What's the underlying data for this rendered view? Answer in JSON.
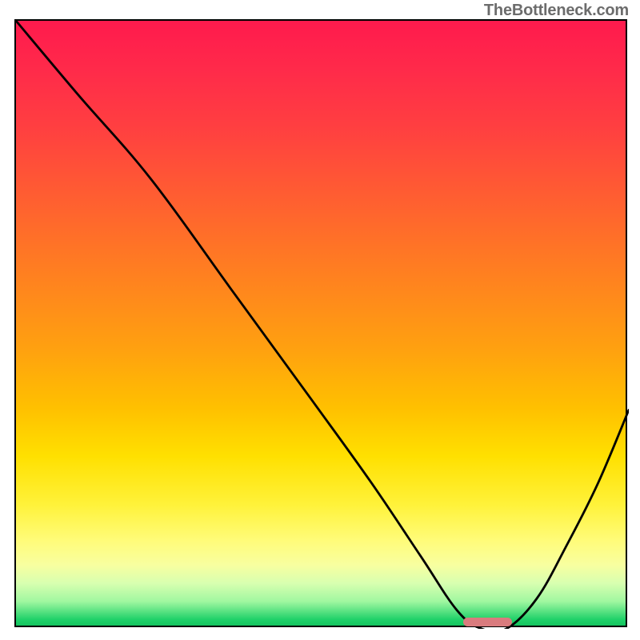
{
  "watermark": "TheBottleneck.com",
  "chart_data": {
    "type": "line",
    "title": "",
    "xlabel": "",
    "ylabel": "",
    "xlim": [
      0,
      100
    ],
    "ylim": [
      0,
      100
    ],
    "series": [
      {
        "name": "bottleneck-curve",
        "x": [
          0,
          10,
          22,
          35,
          48,
          58,
          66,
          72,
          76,
          80,
          85,
          90,
          95,
          100
        ],
        "y": [
          100,
          88,
          74,
          56,
          38,
          24,
          12,
          3,
          0,
          0,
          5,
          14,
          24,
          36
        ]
      }
    ],
    "marker": {
      "x_start": 73,
      "x_end": 81,
      "y": 0
    },
    "gradient_note": "background encodes bottleneck severity: red=high, green=optimal"
  }
}
